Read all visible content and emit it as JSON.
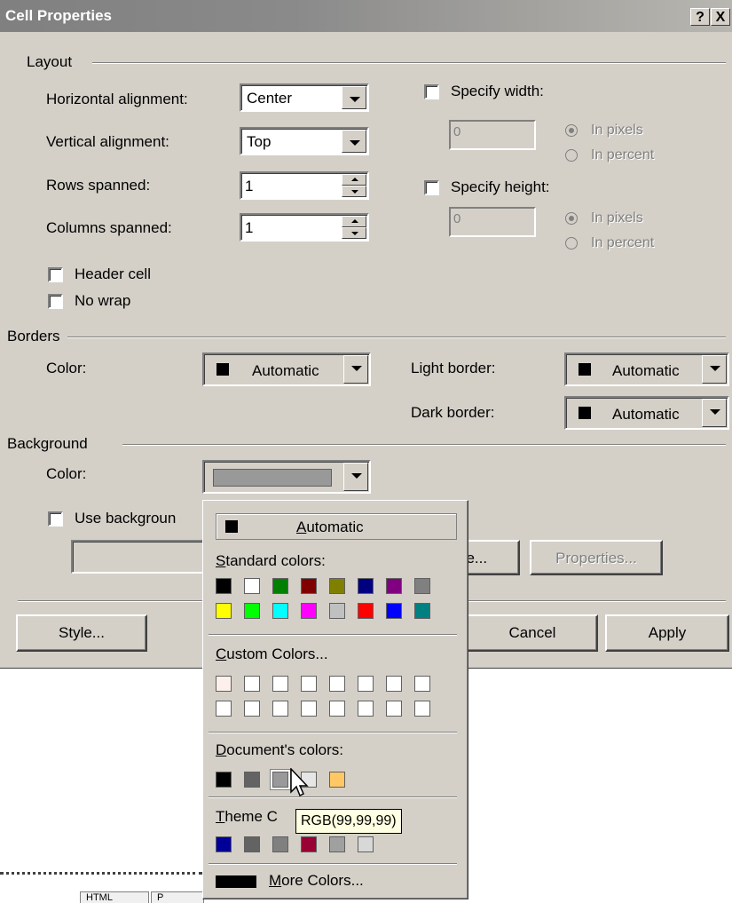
{
  "window": {
    "title": "Cell Properties",
    "help_btn": "?",
    "close_btn": "X"
  },
  "layout": {
    "group_label": "Layout",
    "h_align_label": "Horizontal alignment:",
    "h_align_value": "Center",
    "v_align_label": "Vertical alignment:",
    "v_align_value": "Top",
    "rows_label": "Rows spanned:",
    "rows_value": "1",
    "cols_label": "Columns spanned:",
    "cols_value": "1",
    "header_cell_label": "Header cell",
    "no_wrap_label": "No wrap",
    "specify_width_label": "Specify width:",
    "width_value": "0",
    "specify_height_label": "Specify height:",
    "height_value": "0",
    "in_pixels": "In pixels",
    "in_percent": "In percent"
  },
  "borders": {
    "group_label": "Borders",
    "color_label": "Color:",
    "color_value": "Automatic",
    "light_label": "Light border:",
    "light_value": "Automatic",
    "dark_label": "Dark border:",
    "dark_value": "Automatic"
  },
  "background": {
    "group_label": "Background",
    "color_label": "Color:",
    "use_bg_label": "Use backgroun",
    "browse_label": "se...",
    "properties_label": "Properties..."
  },
  "buttons": {
    "style": "Style...",
    "cancel": "Cancel",
    "apply": "Apply"
  },
  "popup": {
    "automatic": "Automatic",
    "standard_label": "Standard colors:",
    "standard_colors": [
      "#000000",
      "#ffffff",
      "#008000",
      "#800000",
      "#808000",
      "#000080",
      "#800080",
      "#808080",
      "#ffff00",
      "#00ff00",
      "#00ffff",
      "#ff00ff",
      "#c0c0c0",
      "#ff0000",
      "#0000ff",
      "#008080"
    ],
    "custom_label": "Custom Colors...",
    "custom_colors": [
      "#fdf0ec",
      "#ffffff",
      "#ffffff",
      "#ffffff",
      "#ffffff",
      "#ffffff",
      "#ffffff",
      "#ffffff",
      "#ffffff",
      "#ffffff",
      "#ffffff",
      "#ffffff",
      "#ffffff",
      "#ffffff",
      "#ffffff",
      "#ffffff"
    ],
    "document_label": "Document's colors:",
    "document_colors": [
      "#000000",
      "#636363",
      "#999999",
      "#e6e6e6",
      "#ffc864"
    ],
    "theme_label": "Theme C",
    "theme_colors": [
      "#000099",
      "#636363",
      "#808080",
      "#990033",
      "#a0a0a0",
      "#d8d8d8"
    ],
    "more_label": "More Colors...",
    "tooltip": "RGB(99,99,99)"
  },
  "background_color_swatch": "#999999",
  "behind": {
    "tab1": "HTML",
    "tab2": "P"
  }
}
